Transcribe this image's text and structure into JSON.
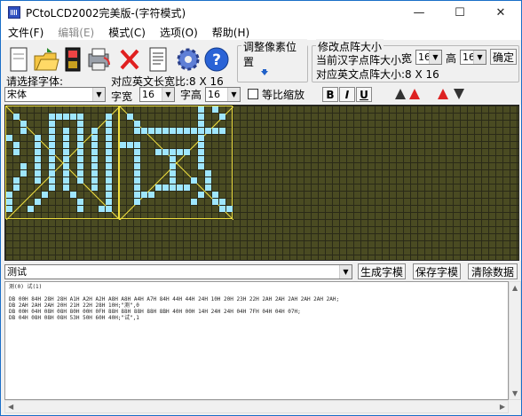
{
  "window": {
    "title": "PCtoLCD2002完美版-(字符模式)"
  },
  "window_buttons": {
    "minimize": "—",
    "maximize": "☐",
    "close": "✕"
  },
  "menu": [
    {
      "label": "文件(F)",
      "enabled": true
    },
    {
      "label": "编辑(E)",
      "enabled": false
    },
    {
      "label": "模式(C)",
      "enabled": true
    },
    {
      "label": "选项(O)",
      "enabled": true
    },
    {
      "label": "帮助(H)",
      "enabled": true
    }
  ],
  "toolbar_icons": [
    "new-icon",
    "open-icon",
    "save-icon",
    "print-icon",
    "delete-icon",
    "document-icon",
    "gear-icon",
    "help-icon"
  ],
  "pixel_adjust": {
    "label": "调整像素位置"
  },
  "matrix": {
    "label": "修改点阵大小",
    "current_label": "当前汉字点阵大小:",
    "width_label": "宽",
    "width_value": "16",
    "height_label": "高",
    "height_value": "16",
    "confirm_label": "确定",
    "english_label": "对应英文点阵大小:8 X 16"
  },
  "font": {
    "select_label": "请选择字体:",
    "font_value": "宋体",
    "english_width_label": "对应英文长宽比:8 X 16",
    "char_width_label": "字宽",
    "char_width_value": "16",
    "char_height_label": "字高",
    "char_height_value": "16",
    "scale_label": "等比缩放",
    "scale_checked": false
  },
  "format_buttons": {
    "bold": "B",
    "italic": "I",
    "underline": "U"
  },
  "input": {
    "text": "测试"
  },
  "actions": {
    "generate": "生成字模",
    "save": "保存字模",
    "clear": "清除数据"
  },
  "colors": {
    "grid_bg": "#4a4b22",
    "pixel_on": "#9fe6ff",
    "frame": "#f0e040"
  },
  "output": {
    "text": "测(0) 试(1)\n\nDB 00H 84H 28H 28H A1H A2H A2H A8H A8H A4H A7H 84H 44H 44H 24H 10H 20H 23H 22H 2AH 2AH 2AH 2AH 2AH 2AH;\nDB 2AH 2AH 2AH 20H 21H 22H 28H 10H;\"测\",0\nDB 00H 04H 08H 08H 80H 00H 0FH 88H 88H 88H 88H 8BH 40H 00H 14H 24H 24H 04H 7FH 04H 04H 07H;\nDB 04H 08H 08H 08H 53H 50H 60H 40H;\"试\",1"
  }
}
